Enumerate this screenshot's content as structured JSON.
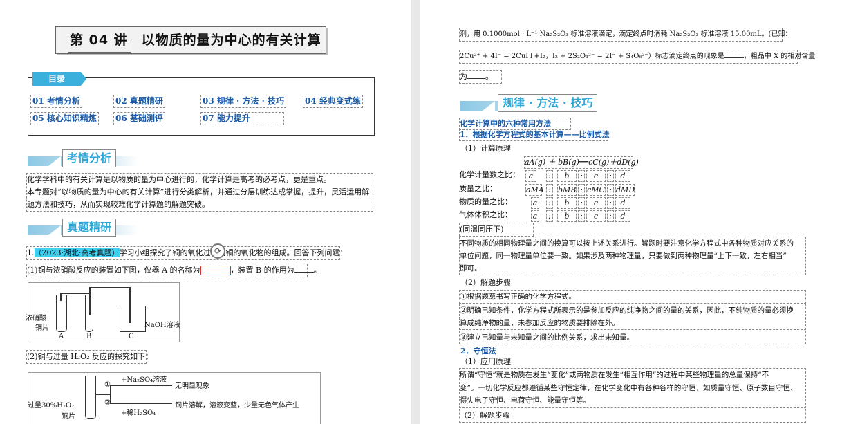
{
  "left": {
    "title": "第 04 讲　以物质的量为中心的有关计算",
    "toc": {
      "tag": "目录",
      "items": [
        "01 考情分析",
        "02 真题精研",
        "03 规律 · 方法 · 技巧",
        "04 经典变式练",
        "05 核心知识精炼",
        "06 基础测评",
        "07 能力提升"
      ]
    },
    "sec1": "考情分析",
    "intro": [
      "化学学科中的有关计算是以物质的量为中心进行的，化学计算是高考的必考点，更是重点。",
      "本专题对“以物质的量为中心的有关计算”进行分类解析，并通过分层训练达成掌握，提升，灵活运用解",
      "题方法和技巧，从而实现较难化学计算题的解题突破。"
    ],
    "sec2": "真题精研",
    "q1_num": "1.",
    "q1_source": "（2023·湖北·高考真题）",
    "q1_text": "学习小组探究了铜的氧化过程及铜的氧化物的组成。回答下列问题：",
    "q1_p1": "(1)铜与浓硝酸反应的装置如下图，仪器 A 的名称为",
    "q1_p1_mid": "，装置 B 的作用为",
    "q1_p1_end": "。",
    "diag1": {
      "label_acid": "浓硝酸",
      "label_cu": "铜片",
      "label_naoh": "NaOH溶液",
      "a": "A",
      "b": "B",
      "c": "C"
    },
    "q1_p2": "(2)铜与过量 H₂O₂ 反应的探究如下：",
    "diag2": {
      "step1_reagent": "+Na₂SO₄溶液",
      "step1_num": "①",
      "step1_result": "无明显现象",
      "step2_reagent": "+稀H₂SO₄",
      "step2_num": "②",
      "step2_result": "铜片溶解，溶液变蓝，少量无色气体产生",
      "label_h2o2": "过量30%H₂O₂",
      "label_cu": "铜片"
    }
  },
  "right": {
    "top1": "剂，用 0.1000mol · L⁻¹ Na₂S₂O₃ 标准溶液滴定，滴定终点时消耗 Na₂S₂O₃ 标准溶液 15.00mL。(已知：",
    "top2": "2Cu²⁺ + 4I⁻ = 2CuI↓+I₂，I₂ + 2S₂O₃²⁻ = 2I⁻ + S₄O₆²⁻）标志滴定终点的现象是",
    "top2_end": "，粗品中 X 的相对含量",
    "top3": "为",
    "top3_end": "。",
    "sec3": "规律 · 方法 · 技巧",
    "h_main": "化学计算中的六种常用方法",
    "h1": "1．根据化学方程式的基本计算——比例式法",
    "sub1": "（1）计算原理",
    "equation": "aA(g) ＋ bB(g)══cC(g)＋dD(g)",
    "rows": [
      {
        "label": "化学计量数之比：",
        "v": [
          "a",
          "b",
          "c",
          "d"
        ]
      },
      {
        "label": "质量之比：",
        "v": [
          "aMA",
          "bMB",
          "cMC",
          "dMD"
        ]
      },
      {
        "label": "物质的量之比：",
        "v": [
          "a",
          "b",
          "c",
          "d"
        ]
      },
      {
        "label": "气体体积之比：",
        "v": [
          "a",
          "b",
          "c",
          "d"
        ]
      }
    ],
    "sep": ":",
    "same_tp": "(同温同压下)",
    "para1": [
      "不同物质的相同物理量之间的换算可以按上述关系进行。解题时要注意化学方程式中各种物质对应关系的",
      "单位问题，同一物理量单位要一致。如果涉及两种物理量，只要做到两种物理量“上下一致，左右相当”",
      "即可。"
    ],
    "sub2": "（2）解题步骤",
    "step1": "①根据题意书写正确的化学方程式。",
    "step2a": "②明确已知条件，化学方程式所表示的是参加反应的纯净物之间的量的关系，因此，不纯物质的量必须换",
    "step2b": "算成纯净物的量，未参加反应的物质要排除在外。",
    "step3": "③建立已知量与未知量之间的比例关系，求出未知量。",
    "h2": "2．守恒法",
    "sub3": "（1）应用原理",
    "para2": [
      "所谓“守恒”就是物质在发生“变化”或两物质在发生“相互作用”的过程中某些物理量的总量保持“不",
      "变”。一切化学反应都遵循某些守恒定律，在化学变化中有各种各样的守恒，如质量守恒、原子数目守恒、",
      "得失电子守恒、电荷守恒、能量守恒等。"
    ],
    "sub4": "（2）解题步骤"
  }
}
